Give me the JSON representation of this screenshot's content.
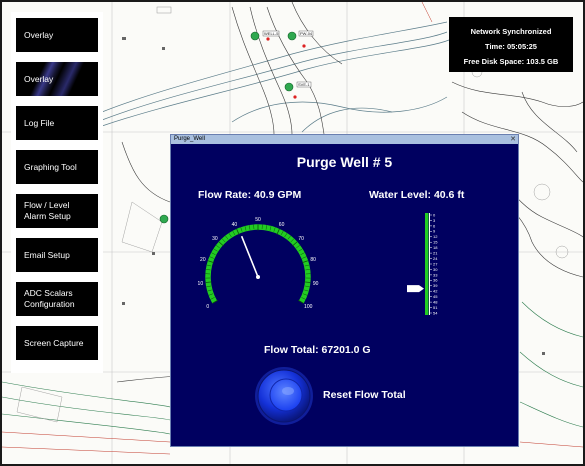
{
  "sidebar": {
    "items": [
      {
        "label": "Overlay"
      },
      {
        "label": "Overlay"
      },
      {
        "label": "Log File"
      },
      {
        "label": "Graphing Tool"
      },
      {
        "label": "Flow / Level Alarm Setup"
      },
      {
        "label": "Email Setup"
      },
      {
        "label": "ADC Scalars Configuration"
      },
      {
        "label": "Screen Capture"
      }
    ]
  },
  "status": {
    "network": "Network Synchronized",
    "time": "Time: 05:05:25",
    "disk": "Free Disk Space: 103.5 GB"
  },
  "dialog": {
    "window_title": "Purge_Well",
    "title": "Purge Well # 5",
    "flow_rate": "Flow Rate: 40.9 GPM",
    "water_level": "Water Level: 40.6 ft",
    "flow_total": "Flow Total: 67201.0 G",
    "reset_label": "Reset Flow Total",
    "flow_gauge": {
      "value": 40.9,
      "min": 0,
      "max": 100,
      "ticks": [
        "0",
        "10",
        "20",
        "30",
        "40",
        "50",
        "60",
        "70",
        "80",
        "90",
        "100"
      ]
    },
    "level_gauge": {
      "value": 40.6,
      "ticks": [
        "0",
        "3",
        "6",
        "9",
        "12",
        "15",
        "18",
        "21",
        "24",
        "27",
        "30",
        "33",
        "36",
        "39",
        "42",
        "45",
        "48",
        "51",
        "54"
      ]
    }
  },
  "map": {
    "markers": [
      "WELL-5",
      "PW-04",
      "SVE-1"
    ]
  },
  "colors": {
    "dialog_bg": "#000060",
    "gauge_green": "#22cc22",
    "button_blue": "#1a3ff0",
    "titlebar": "#a9c0df"
  }
}
